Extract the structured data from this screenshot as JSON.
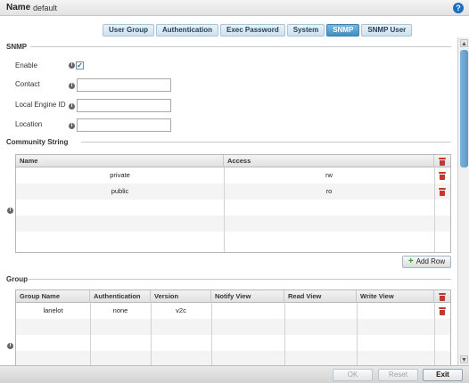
{
  "header": {
    "name_label": "Name",
    "name_value": "default",
    "help_icon": "?"
  },
  "tabs": [
    {
      "label": "User Group",
      "active": false
    },
    {
      "label": "Authentication",
      "active": false
    },
    {
      "label": "Exec Password",
      "active": false
    },
    {
      "label": "System",
      "active": false
    },
    {
      "label": "SNMP",
      "active": true
    },
    {
      "label": "SNMP User",
      "active": false
    }
  ],
  "snmp": {
    "title": "SNMP",
    "enable_label": "Enable",
    "enable_checked": true,
    "contact_label": "Contact",
    "contact_value": "",
    "engine_label": "Local Engine ID",
    "engine_value": "",
    "location_label": "Location",
    "location_value": ""
  },
  "community": {
    "title": "Community String",
    "columns": [
      "Name",
      "Access"
    ],
    "rows": [
      {
        "name": "private",
        "access": "rw"
      },
      {
        "name": "public",
        "access": "ro"
      }
    ],
    "add_row_label": "Add Row"
  },
  "group": {
    "title": "Group",
    "columns": [
      "Group Name",
      "Authentication",
      "Version",
      "Notify View",
      "Read View",
      "Write View"
    ],
    "rows": [
      {
        "group_name": "lanelot",
        "authentication": "none",
        "version": "v2c",
        "notify_view": "",
        "read_view": "",
        "write_view": ""
      }
    ]
  },
  "footer": {
    "ok_label": "OK",
    "reset_label": "Reset",
    "exit_label": "Exit"
  },
  "colors": {
    "accent": "#3d8fc4",
    "delete": "#c0392b",
    "add": "#2e9a2e"
  },
  "icons": {
    "help": "help-icon",
    "info": "info-icon",
    "delete": "trash-icon",
    "add": "plus-icon"
  }
}
